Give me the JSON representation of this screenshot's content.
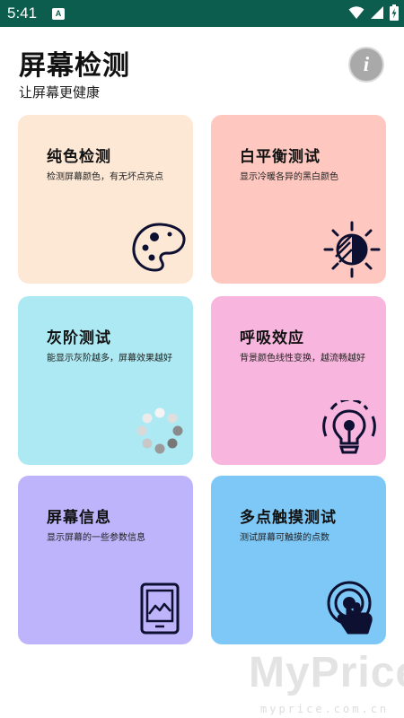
{
  "status_bar": {
    "time": "5:41",
    "app_icon_letter": "A"
  },
  "header": {
    "title": "屏幕检测",
    "subtitle": "让屏幕更健康",
    "info_button_glyph": "i"
  },
  "cards": [
    {
      "title": "纯色检测",
      "description": "检测屏幕颜色，有无坏点亮点",
      "background": "#fde8d6",
      "icon": "palette-icon"
    },
    {
      "title": "白平衡测试",
      "description": "显示冷暖各异的黑白颜色",
      "background": "#fec7bf",
      "icon": "brightness-icon"
    },
    {
      "title": "灰阶测试",
      "description": "能显示灰阶越多，屏幕效果越好",
      "background": "#ace9f2",
      "icon": "loading-dots-icon"
    },
    {
      "title": "呼吸效应",
      "description": "背景颜色线性变换，越流畅越好",
      "background": "#f8b5dd",
      "icon": "lightbulb-icon"
    },
    {
      "title": "屏幕信息",
      "description": "显示屏幕的一些参数信息",
      "background": "#beb4fb",
      "icon": "tablet-image-icon"
    },
    {
      "title": "多点触摸测试",
      "description": "测试屏幕可触摸的点数",
      "background": "#7ec8f8",
      "icon": "touch-icon"
    }
  ],
  "watermark": {
    "brand": "MyPrice",
    "url": "myprice.com.cn"
  },
  "colors": {
    "status_bar": "#0c5d4d",
    "info_button": "#a9a9a9",
    "icon_stroke": "#0d1030"
  }
}
